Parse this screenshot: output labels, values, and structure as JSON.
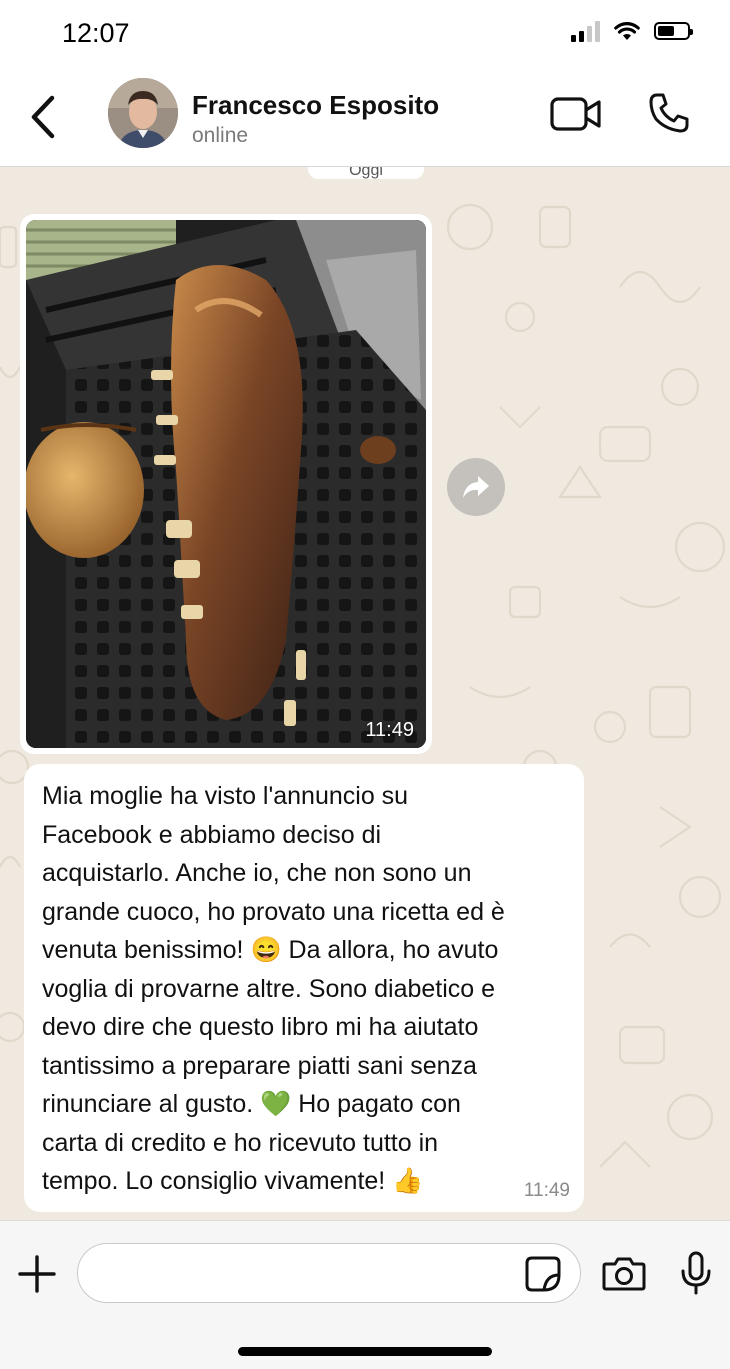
{
  "status_bar": {
    "time": "12:07",
    "icons": [
      "signal-icon",
      "wifi-icon",
      "battery-icon"
    ]
  },
  "header": {
    "back_icon": "chevron-left-icon",
    "contact_name": "Francesco Esposito",
    "contact_status": "online",
    "actions": [
      "video-call-icon",
      "phone-call-icon"
    ]
  },
  "chat": {
    "date_pill": "Oggi",
    "messages": [
      {
        "type": "image",
        "description_icon": "photo",
        "time": "11:49"
      },
      {
        "type": "text",
        "text": "Mia moglie ha visto l'annuncio su\nFacebook e abbiamo deciso di\nacquistarlo. Anche io, che non sono un\ngrande cuoco, ho provato una ricetta ed è\nvenuta benissimo! 😄 Da allora, ho avuto\nvoglia di provarne altre. Sono diabetico e\ndevo dire che questo libro mi ha aiutato\ntantissimo a preparare piatti sani senza\nrinunciare al gusto. 💚 Ho pagato con\ncarta di credito e ho ricevuto tutto in\ntempo. Lo consiglio vivamente! 👍",
        "time": "11:49"
      }
    ],
    "forward_icon": "forward-icon"
  },
  "input_bar": {
    "plus_icon": "plus-icon",
    "field_value": "",
    "sticker_icon": "sticker-icon",
    "camera_icon": "camera-icon",
    "mic_icon": "microphone-icon"
  },
  "colors": {
    "chat_background": "#efe9df",
    "bubble": "#ffffff",
    "text": "#111111",
    "muted": "#7a7a7a"
  }
}
